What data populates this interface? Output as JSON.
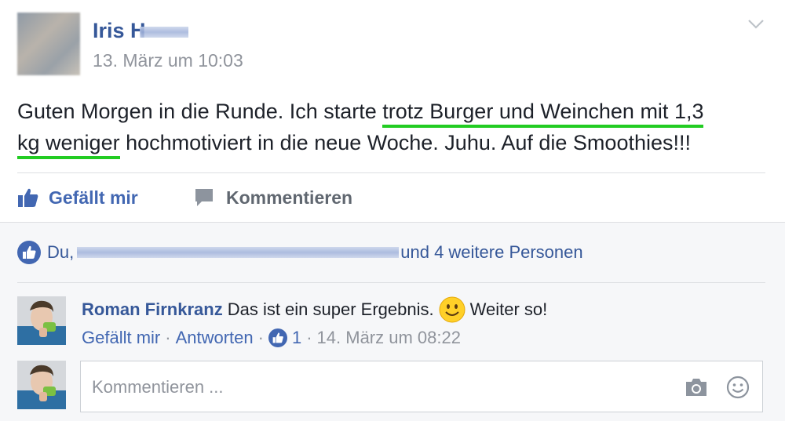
{
  "post": {
    "author_name": "Iris H",
    "timestamp": "13. März um 10:03",
    "text_before": "Guten Morgen in die Runde. Ich starte ",
    "text_highlight_1": "trotz Burger und Weinchen mit 1,3",
    "text_highlight_2": "kg weniger",
    "text_after": " hochmotiviert in die neue Woche. Juhu. Auf die Smoothies!!!",
    "highlight_color": "#22cc22"
  },
  "actions": {
    "like_label": "Gefällt mir",
    "comment_label": "Kommentieren"
  },
  "likes": {
    "prefix": "Du,",
    "suffix": "und 4 weitere Personen"
  },
  "comments": [
    {
      "author": "Roman Firnkranz",
      "text_before": "Das ist ein super Ergebnis.",
      "text_after": "Weiter so!",
      "like_label": "Gefällt mir",
      "reply_label": "Antworten",
      "sep": "·",
      "reaction_count": "1",
      "timestamp": "14. März um 08:22"
    }
  ],
  "composer": {
    "placeholder": "Kommentieren ..."
  },
  "colors": {
    "link": "#365899",
    "action_blue": "#4267b2",
    "muted": "#90949c",
    "footer_bg": "#f6f7f9"
  },
  "icons": [
    "chevron-down-icon",
    "thumbs-up-icon",
    "comment-bubble-icon",
    "like-badge-icon",
    "smiley-emoji-icon",
    "camera-icon",
    "emoji-icon"
  ]
}
